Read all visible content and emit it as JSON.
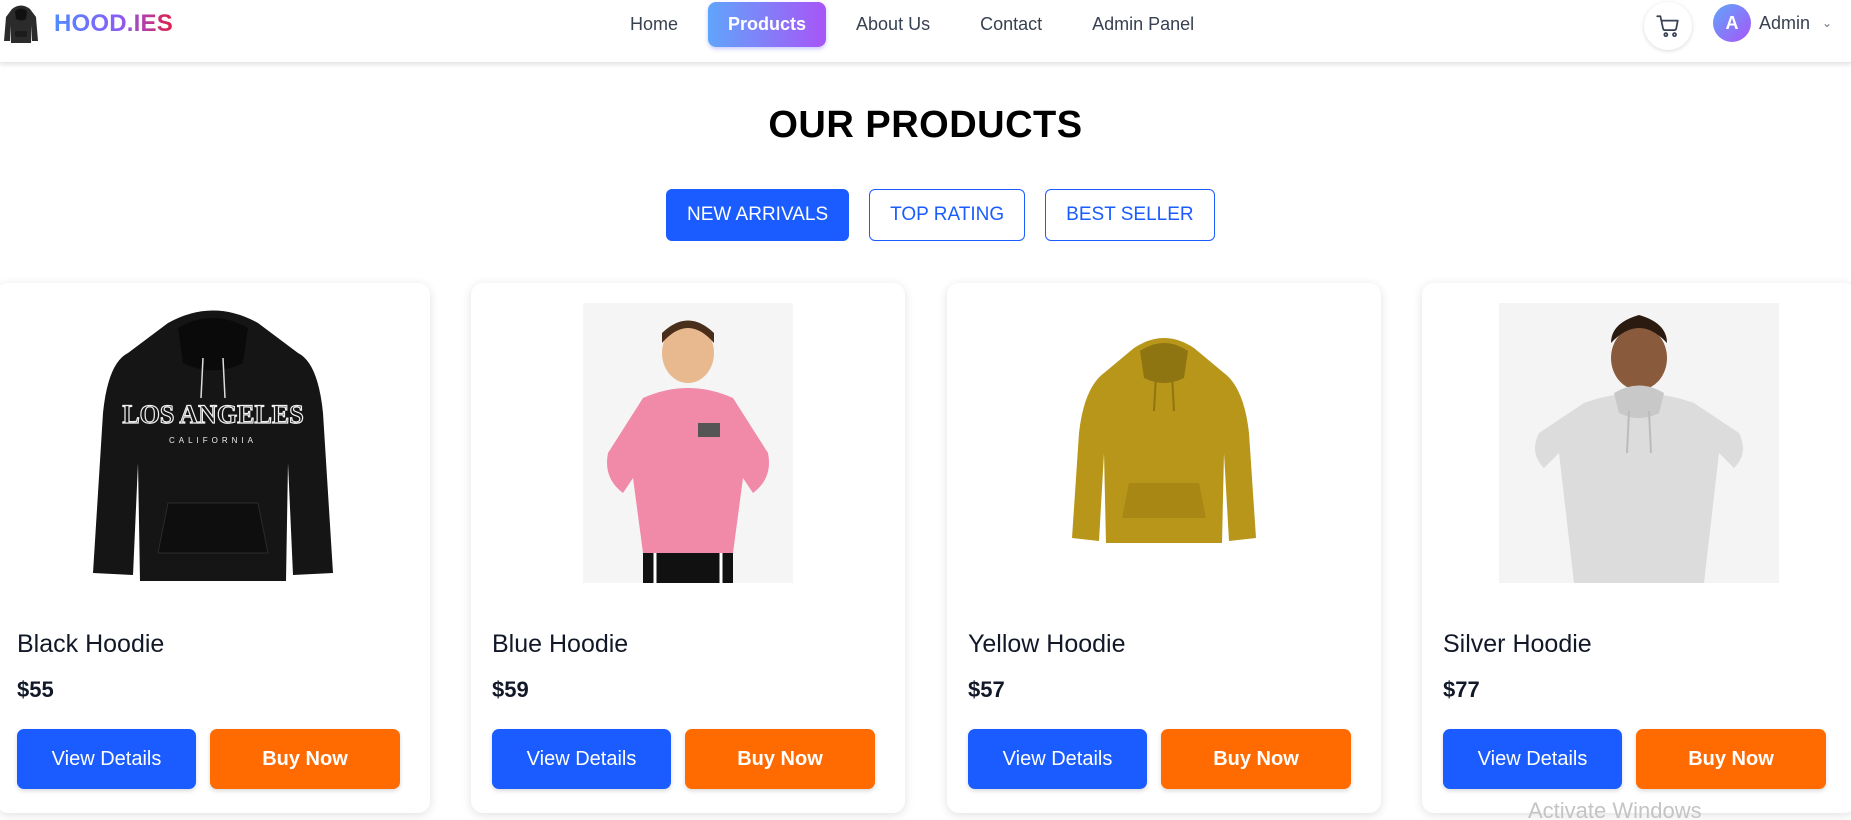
{
  "brand": {
    "name": "HOOD.IES"
  },
  "nav": {
    "links": [
      {
        "label": "Home"
      },
      {
        "label": "Products",
        "active": true
      },
      {
        "label": "About Us"
      },
      {
        "label": "Contact"
      },
      {
        "label": "Admin Panel"
      }
    ]
  },
  "user": {
    "initial": "A",
    "name": "Admin"
  },
  "page": {
    "title": "OUR PRODUCTS"
  },
  "filters": [
    {
      "label": "NEW ARRIVALS",
      "active": true
    },
    {
      "label": "TOP RATING"
    },
    {
      "label": "BEST SELLER"
    }
  ],
  "products": [
    {
      "name": "Black Hoodie",
      "price": "$55",
      "color": "#151515",
      "print": "LOS ANGELES",
      "subprint": "CALIFORNIA",
      "view_label": "View Details",
      "buy_label": "Buy Now"
    },
    {
      "name": "Blue Hoodie",
      "price": "$59",
      "color": "#f08aa8",
      "view_label": "View Details",
      "buy_label": "Buy Now"
    },
    {
      "name": "Yellow Hoodie",
      "price": "$57",
      "color": "#b8961a",
      "view_label": "View Details",
      "buy_label": "Buy Now"
    },
    {
      "name": "Silver Hoodie",
      "price": "$77",
      "color": "#dcdcdc",
      "view_label": "View Details",
      "buy_label": "Buy Now"
    }
  ],
  "watermark": "Activate Windows",
  "colors": {
    "primary": "#1a5cff",
    "buy": "#ff6b00",
    "nav_gradient_start": "#60a5fa",
    "nav_gradient_end": "#a855f7"
  }
}
